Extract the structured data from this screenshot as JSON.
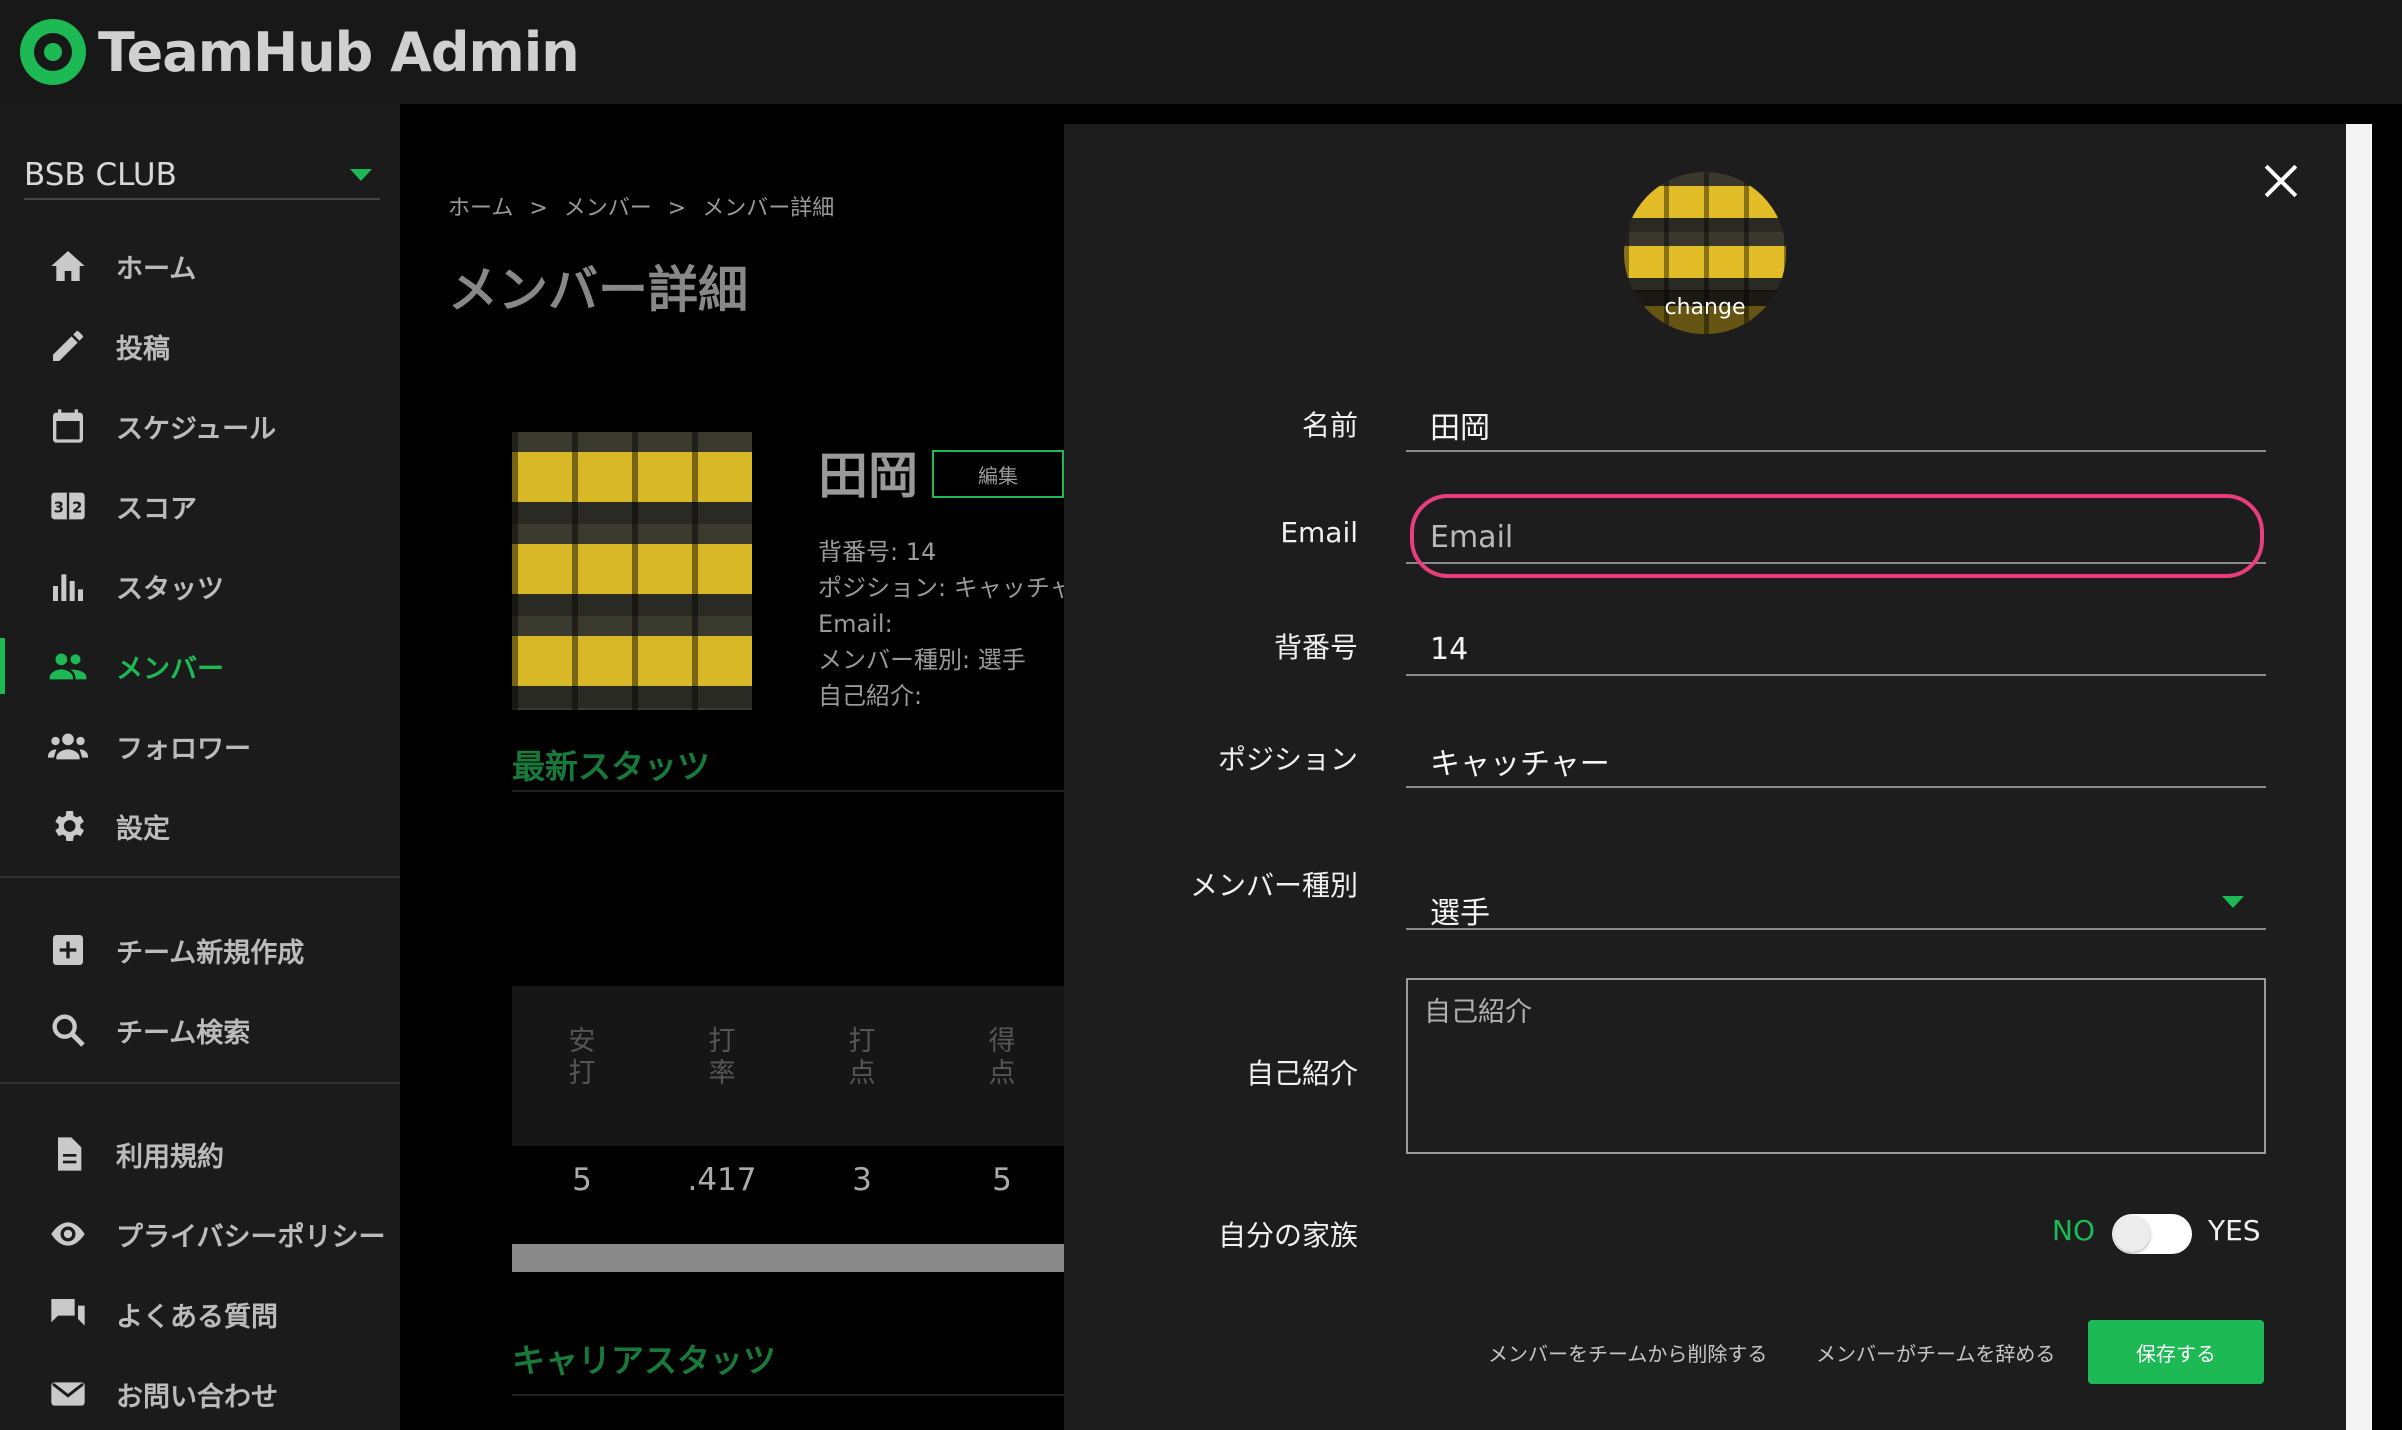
{
  "app": {
    "title": "TeamHub Admin"
  },
  "sidebar": {
    "club": "BSB CLUB",
    "items": [
      {
        "label": "ホーム",
        "icon": "home-icon"
      },
      {
        "label": "投稿",
        "icon": "pencil-icon"
      },
      {
        "label": "スケジュール",
        "icon": "calendar-icon"
      },
      {
        "label": "スコア",
        "icon": "scoreboard-icon"
      },
      {
        "label": "スタッツ",
        "icon": "bar-chart-icon"
      },
      {
        "label": "メンバー",
        "icon": "people-icon",
        "active": true
      },
      {
        "label": "フォロワー",
        "icon": "followers-icon"
      },
      {
        "label": "設定",
        "icon": "gear-icon"
      }
    ],
    "team_items": [
      {
        "label": "チーム新規作成",
        "icon": "plus-box-icon"
      },
      {
        "label": "チーム検索",
        "icon": "search-icon"
      }
    ],
    "info_items": [
      {
        "label": "利用規約",
        "icon": "document-icon"
      },
      {
        "label": "プライバシーポリシー",
        "icon": "eye-icon"
      },
      {
        "label": "よくある質問",
        "icon": "chat-icon"
      },
      {
        "label": "お問い合わせ",
        "icon": "mail-icon"
      }
    ]
  },
  "main": {
    "breadcrumb": [
      "ホーム",
      "メンバー",
      "メンバー詳細"
    ],
    "page_title": "メンバー詳細",
    "profile": {
      "name": "田岡",
      "edit_label": "編集",
      "number_line": "背番号: 14",
      "position_line": "ポジション: キャッチャ",
      "email_line": "Email:",
      "type_line": "メンバー種別: 選手",
      "intro_line": "自己紹介:"
    },
    "latest_stats_title": "最新スタッツ",
    "stats_headers": [
      "安\n打",
      "打\n率",
      "打\n点",
      "得\n点"
    ],
    "stats_values": [
      "5",
      ".417",
      "3",
      "5"
    ],
    "career_stats_title": "キャリアスタッツ"
  },
  "dialog": {
    "avatar_change": "change",
    "fields": {
      "name_label": "名前",
      "name_value": "田岡",
      "email_label": "Email",
      "email_placeholder": "Email",
      "number_label": "背番号",
      "number_value": "14",
      "position_label": "ポジション",
      "position_value": "キャッチャー",
      "type_label": "メンバー種別",
      "type_value": "選手",
      "intro_label": "自己紹介",
      "intro_placeholder": "自己紹介",
      "family_label": "自分の家族",
      "toggle_no": "NO",
      "toggle_yes": "YES",
      "toggle_value": false
    },
    "actions": {
      "remove_label": "メンバーをチームから削除する",
      "leave_label": "メンバーがチームを辞める",
      "save_label": "保存する"
    }
  },
  "colors": {
    "accent": "#1db954",
    "highlight_ring": "#e83e7b",
    "dialog_bg": "#1d1d1d",
    "sidebar_bg": "#1b1b1b"
  }
}
